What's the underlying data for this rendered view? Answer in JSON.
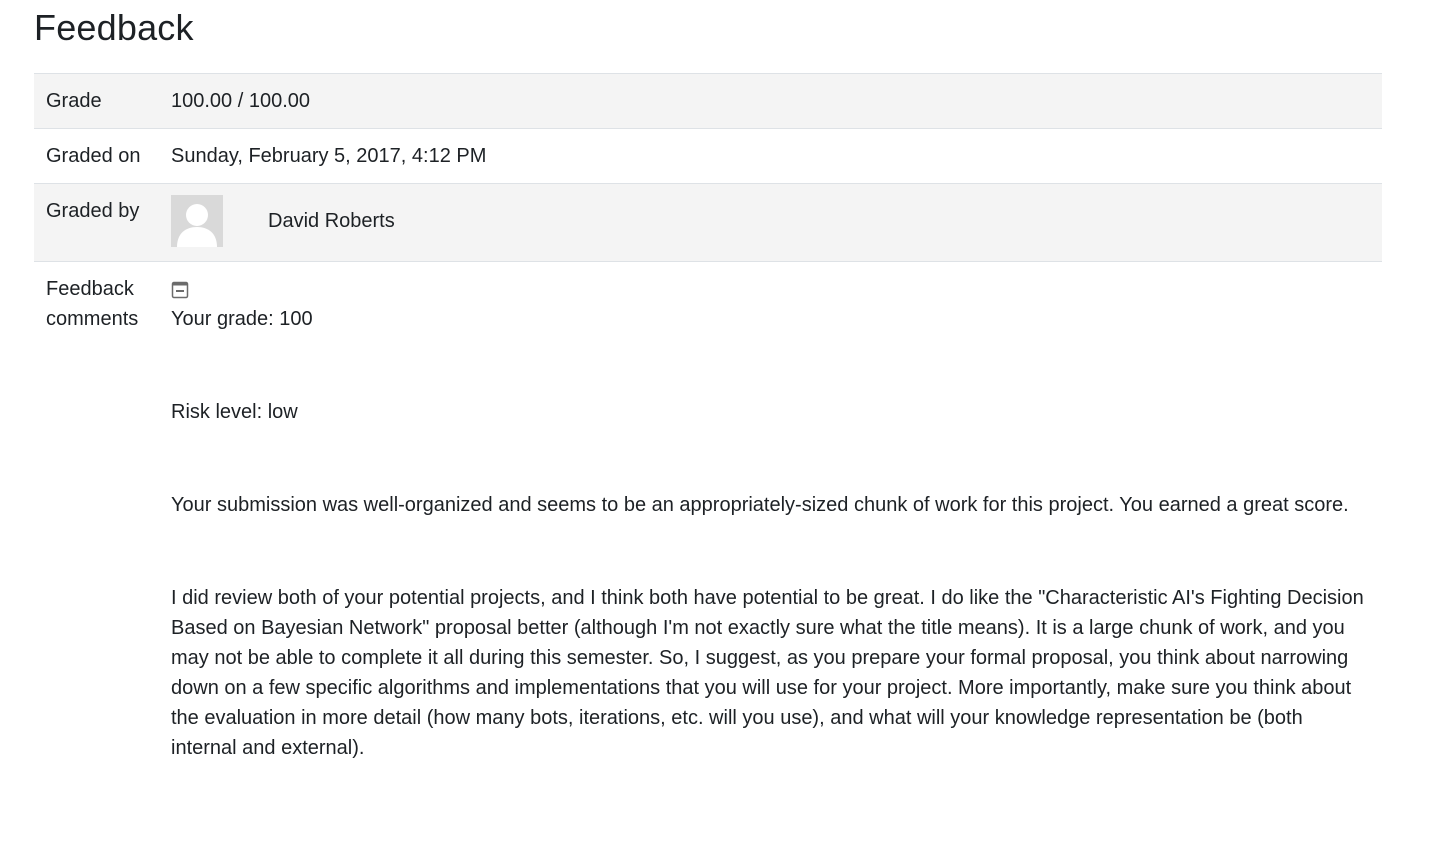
{
  "section": {
    "title": "Feedback"
  },
  "rows": {
    "grade": {
      "label": "Grade",
      "value": "100.00 / 100.00"
    },
    "graded_on": {
      "label": "Graded on",
      "value": "Sunday, February 5, 2017, 4:12 PM"
    },
    "graded_by": {
      "label": "Graded by",
      "name": "David Roberts",
      "avatar_icon": "user-silhouette-icon"
    },
    "feedback_comments": {
      "label_line1": "Feedback",
      "label_line2": "comments",
      "collapse_icon": "collapse-icon",
      "paragraphs": [
        "Your grade: 100",
        "Risk level: low",
        "Your submission was well-organized and seems to be an appropriately-sized chunk of work for this project. You earned a great score.",
        "I did review both of your potential projects, and I think both have potential to be great. I do like the \"Characteristic AI's Fighting Decision Based on Bayesian Network\" proposal better (although I'm not exactly sure what the title means). It is a large chunk of work, and you may not be able to complete it all during this semester. So, I suggest, as you prepare your formal proposal, you think about narrowing down on a few specific algorithms and implementations that you will use for your project. More importantly, make sure you think about the evaluation in more detail (how many bots, iterations, etc. will you use), and what will your knowledge representation be (both internal and external)."
      ]
    }
  },
  "colors": {
    "shaded_row": "#f4f4f4",
    "border": "#dee2e6",
    "text": "#1d2125",
    "avatar_bg": "#d6d6d6"
  }
}
